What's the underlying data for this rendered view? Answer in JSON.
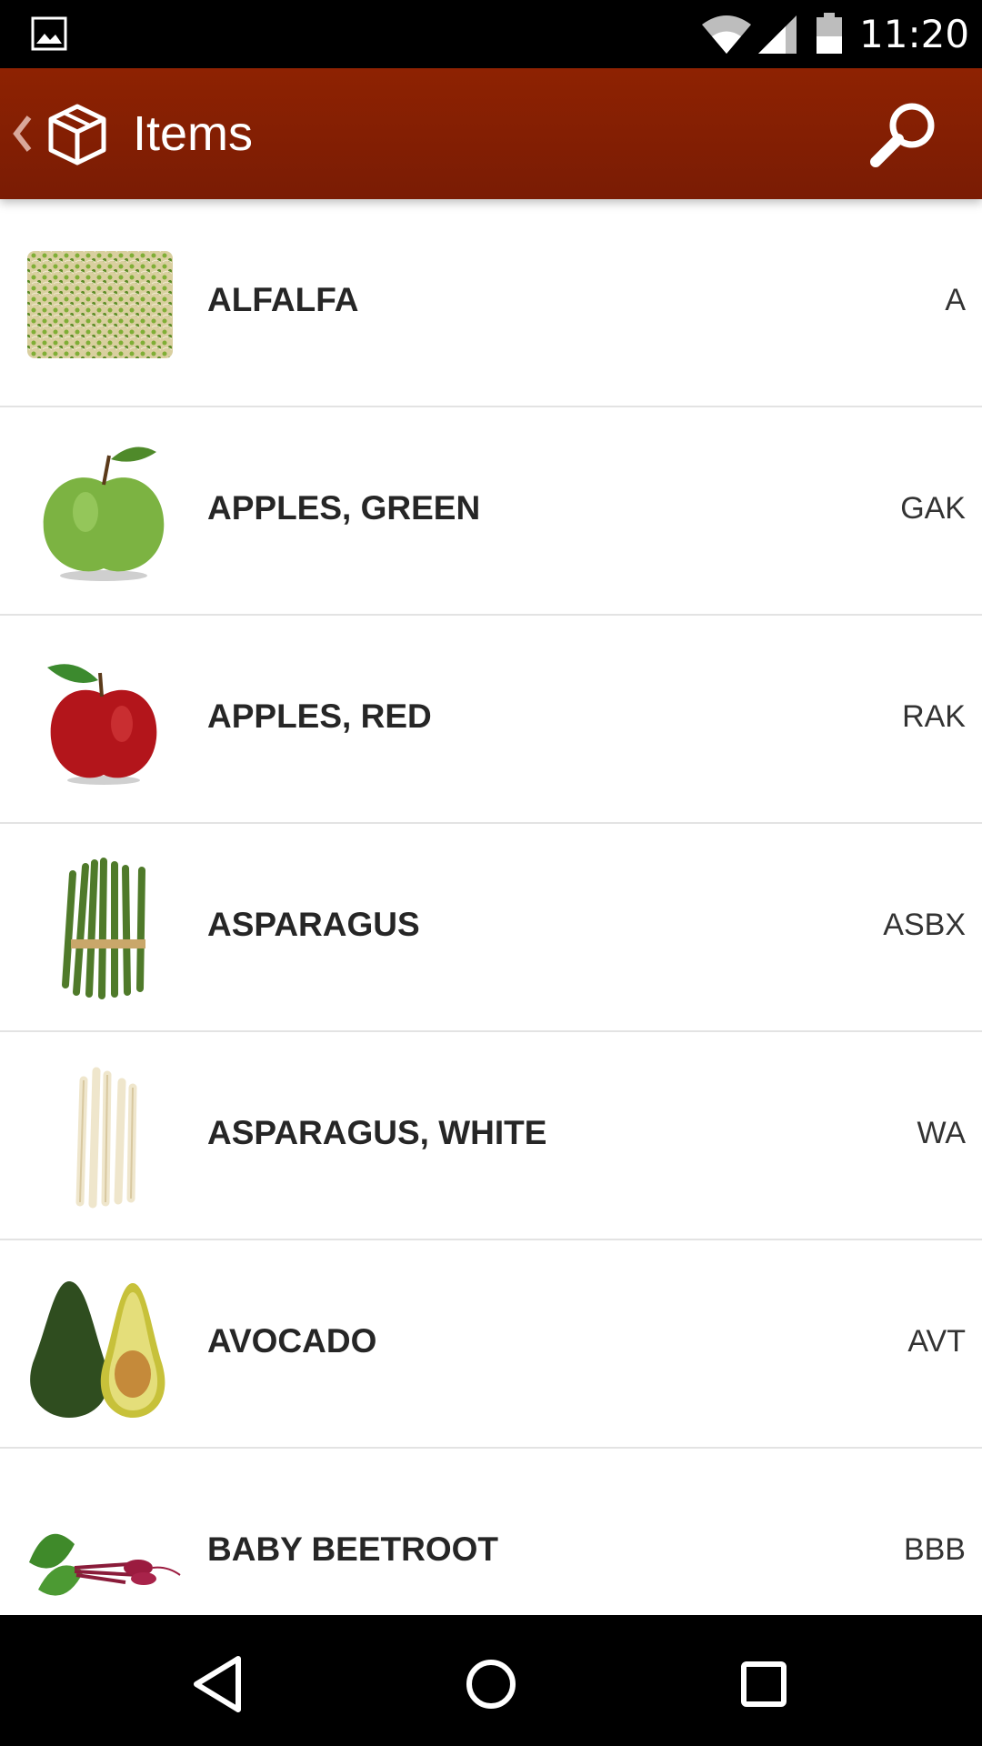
{
  "status_bar": {
    "time": "11:20",
    "icons": [
      "gallery-icon",
      "wifi-icon",
      "signal-icon",
      "battery-icon"
    ]
  },
  "app_bar": {
    "title": "Items",
    "background": "#8e2202",
    "icons": [
      "up-arrow-icon",
      "box-icon",
      "search-icon"
    ]
  },
  "items": [
    {
      "name": "ALFALFA",
      "code": "A",
      "image": "alfalfa-sprouts"
    },
    {
      "name": "APPLES, GREEN",
      "code": "GAK",
      "image": "green-apple"
    },
    {
      "name": "APPLES, RED",
      "code": "RAK",
      "image": "red-apple"
    },
    {
      "name": "ASPARAGUS",
      "code": "ASBX",
      "image": "green-asparagus"
    },
    {
      "name": "ASPARAGUS, WHITE",
      "code": "WA",
      "image": "white-asparagus"
    },
    {
      "name": "AVOCADO",
      "code": "AVT",
      "image": "avocado"
    },
    {
      "name": "BABY BEETROOT",
      "code": "BBB",
      "image": "baby-beetroot"
    }
  ],
  "nav_bar": {
    "icons": [
      "back-icon",
      "home-icon",
      "recents-icon"
    ]
  }
}
